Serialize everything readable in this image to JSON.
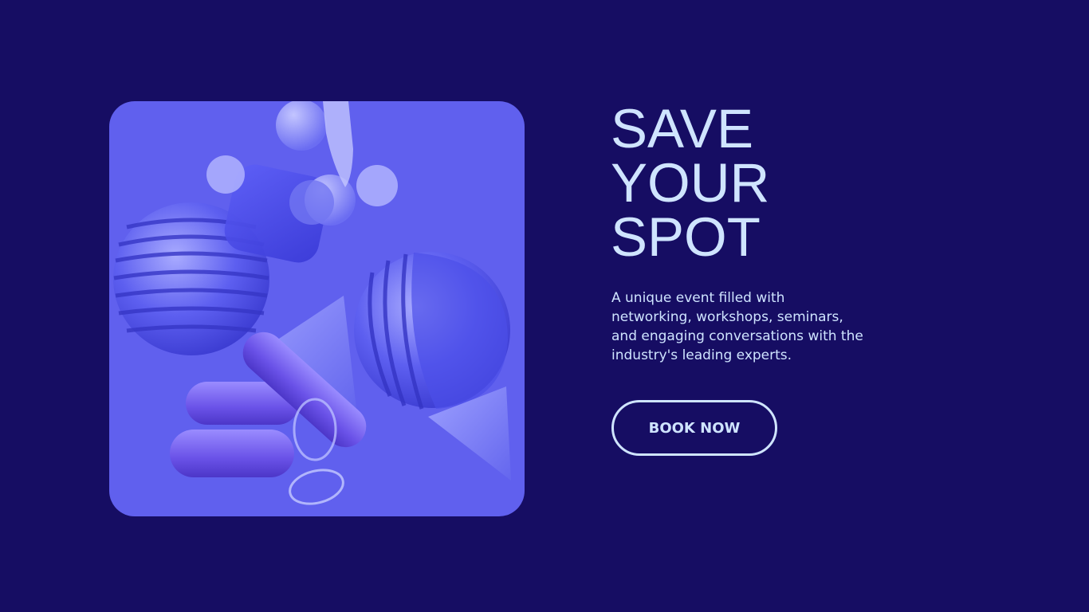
{
  "hero": {
    "headline_lines": [
      "SAVE",
      "YOUR",
      "SPOT"
    ],
    "description": "A unique event filled with networking, workshops, seminars, and engaging conversations with the industry's leading experts.",
    "cta_label": "BOOK NOW"
  },
  "image": {
    "icon": "abstract-3d-shapes-illustration"
  },
  "colors": {
    "page_background": "#160d63",
    "image_background": "#6060ee",
    "text": "#cfe4ff",
    "shape_primary": "#4a4ae6",
    "shape_light": "#8a8cf5"
  }
}
